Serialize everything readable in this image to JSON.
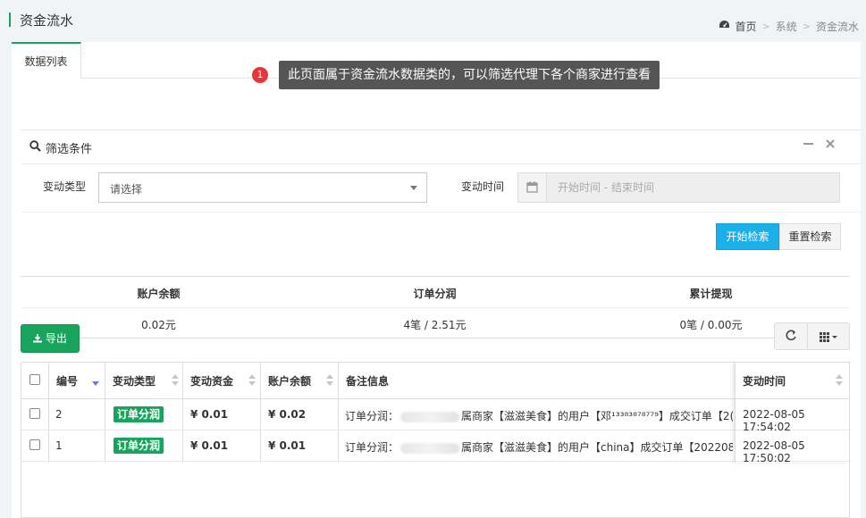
{
  "page": {
    "title": "资金流水",
    "breadcrumb": [
      "首页",
      "系统",
      "资金流水"
    ]
  },
  "tabs": [
    {
      "label": "数据列表"
    }
  ],
  "tip": {
    "number": "1",
    "text": "此页面属于资金流水数据类的，可以筛选代理下各个商家进行查看"
  },
  "filter": {
    "title": "筛选条件",
    "change_type_label": "变动类型",
    "change_type_value": "请选择",
    "change_time_label": "变动时间",
    "date_placeholder": "开始时间 - 结束时间",
    "search_button": "开始检索",
    "reset_button": "重置检索"
  },
  "stats": {
    "headers": [
      "账户余额",
      "订单分润",
      "累计提现"
    ],
    "values": [
      "0.02元",
      "4笔 / 2.51元",
      "0笔 / 0.00元"
    ]
  },
  "toolbar": {
    "export_label": "导出"
  },
  "table": {
    "columns": [
      "编号",
      "变动类型",
      "变动资金",
      "账户余额",
      "备注信息",
      "变动时间"
    ],
    "rows": [
      {
        "id": "2",
        "type": "订单分润",
        "amount": "¥ 0.01",
        "balance": "¥ 0.02",
        "remark_prefix": "订单分润：",
        "remark_rest": "属商家【滋滋美食】的用户【邓¹³³⁸³⁸⁷⁸⁷⁷⁹】成交订单【2(",
        "time": "2022-08-05 17:54:02"
      },
      {
        "id": "1",
        "type": "订单分润",
        "amount": "¥ 0.01",
        "balance": "¥ 0.01",
        "remark_prefix": "订单分润：",
        "remark_rest": "属商家【滋滋美食】的用户【china】成交订单【2022080",
        "time": "2022-08-05 17:50:02"
      }
    ]
  },
  "colors": {
    "accent": "#18a45c",
    "search_button": "#1ab0e8",
    "tip_badge": "#e8353b",
    "sort_active": "#5b7fd6"
  },
  "icons": [
    "dashboard-icon",
    "search-icon",
    "minimize-icon",
    "close-icon",
    "calendar-icon",
    "download-icon",
    "refresh-icon",
    "grid-icon",
    "caret-down-icon"
  ]
}
